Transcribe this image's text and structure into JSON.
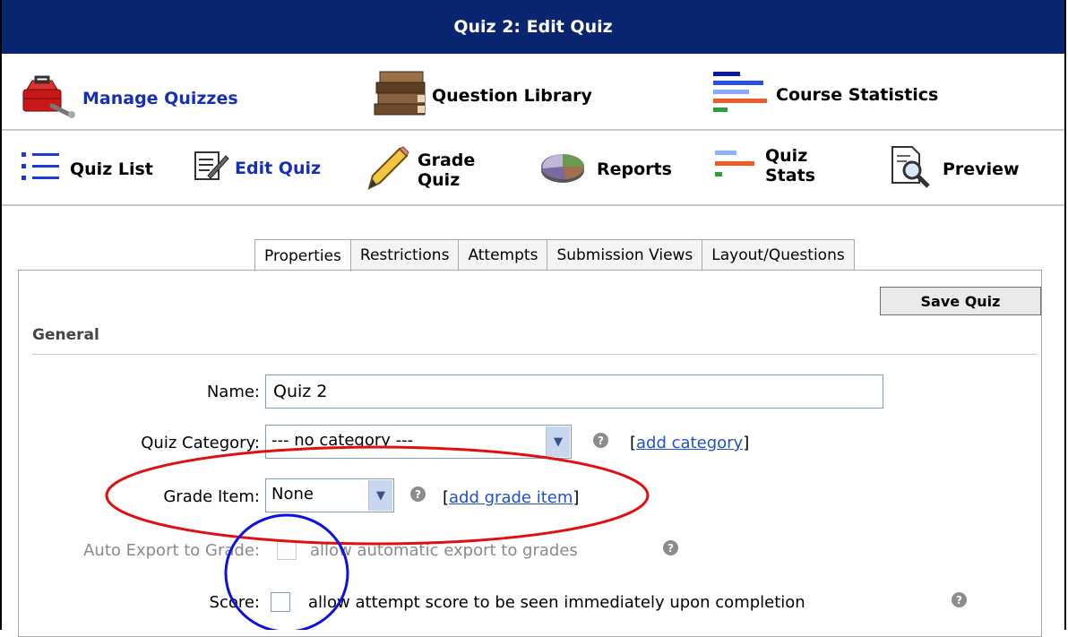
{
  "header": {
    "title": "Quiz 2: Edit Quiz"
  },
  "nav_primary": [
    {
      "label": "Manage Quizzes",
      "icon": "toolbox-icon"
    },
    {
      "label": "Question Library",
      "icon": "books-icon"
    },
    {
      "label": "Course Statistics",
      "icon": "bar-stats-icon"
    }
  ],
  "nav_secondary": [
    {
      "label": "Quiz List",
      "icon": "list-icon"
    },
    {
      "label": "Edit Quiz",
      "icon": "edit-note-icon"
    },
    {
      "label1": "Grade",
      "label2": "Quiz",
      "icon": "pencil-icon"
    },
    {
      "label": "Reports",
      "icon": "pie-chart-icon"
    },
    {
      "label1": "Quiz",
      "label2": "Stats",
      "icon": "bar-stats-icon"
    },
    {
      "label": "Preview",
      "icon": "magnifier-document-icon"
    }
  ],
  "tabs": [
    "Properties",
    "Restrictions",
    "Attempts",
    "Submission Views",
    "Layout/Questions"
  ],
  "save_label": "Save Quiz",
  "section_title": "General",
  "form": {
    "name_label": "Name:",
    "name_value": "Quiz 2",
    "category_label": "Quiz Category:",
    "category_value": "--- no category ---",
    "category_link": "add category",
    "grade_label": "Grade Item:",
    "grade_value": "None",
    "grade_link": "add grade item",
    "export_label": "Auto Export to Grade:",
    "export_text": "allow automatic export to grades",
    "score_label": "Score:",
    "score_text": "allow attempt score to be seen immediately upon completion"
  },
  "colors": {
    "header_bg": "#0a2570",
    "active_link": "#1830b0",
    "link": "#2050c8",
    "annotation_red": "#e01010",
    "annotation_blue": "#1010e0"
  }
}
